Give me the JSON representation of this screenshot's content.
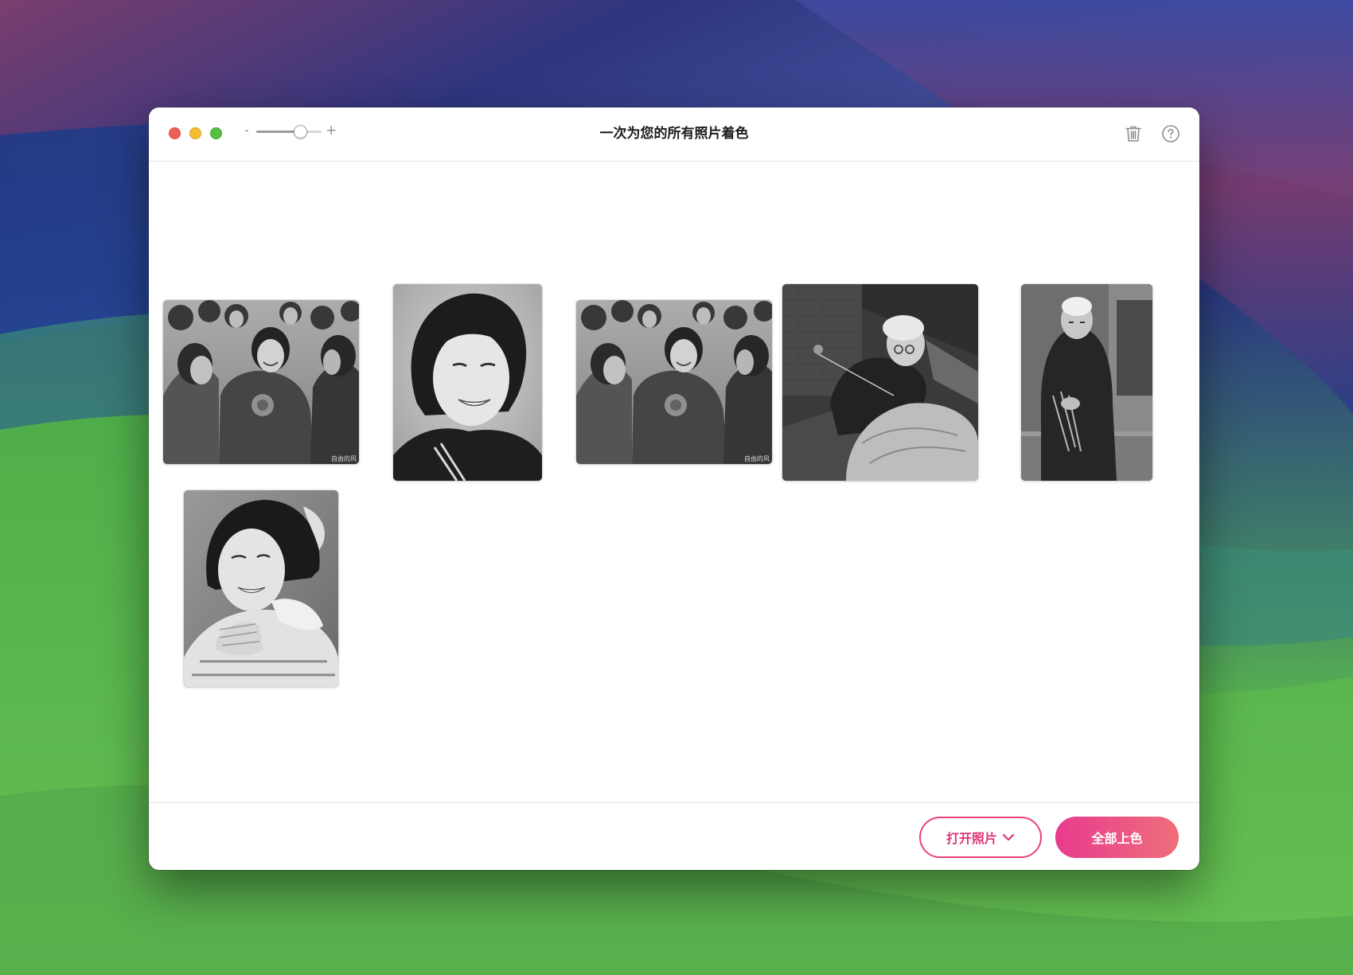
{
  "window": {
    "title": "一次为您的所有照片着色"
  },
  "toolbar": {
    "zoom_out_label": "-",
    "zoom_in_label": "+",
    "zoom_level": 0.72,
    "trash_icon": "trash-icon",
    "help_icon": "help-circle-icon"
  },
  "photos": [
    {
      "description": "group-smiling-women",
      "watermark": "自由的风"
    },
    {
      "description": "woman-portrait-smiling"
    },
    {
      "description": "group-smiling-women",
      "watermark": "自由的风"
    },
    {
      "description": "elderly-woman-sewing"
    },
    {
      "description": "elderly-man-sitting"
    },
    {
      "description": "young-woman-sweater-portrait"
    }
  ],
  "footer": {
    "open_photos_label": "打开照片",
    "colorize_all_label": "全部上色"
  },
  "colors": {
    "accent_pink": "#e83a8e",
    "accent_coral": "#ee6f7a",
    "close": "#ed5f57",
    "minimize": "#f5bc31",
    "zoom": "#56c03f"
  }
}
